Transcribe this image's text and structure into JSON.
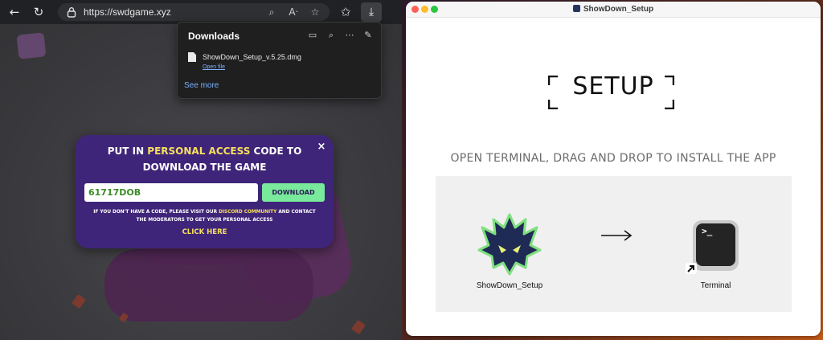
{
  "browser": {
    "url": "https://swdgame.xyz",
    "icons": {
      "back": "arrow-left-icon",
      "refresh": "refresh-icon",
      "lock": "lock-icon",
      "zoom": "zoom-icon",
      "read_aloud": "read-aloud-icon",
      "favorite": "star-icon",
      "favorites_bar": "favorites-icon",
      "download": "download-icon"
    },
    "downloads_panel": {
      "title": "Downloads",
      "file_name": "ShowDown_Setup_v.5.25.dmg",
      "open_file": "Open file",
      "see_more": "See more"
    }
  },
  "modal": {
    "title_line1_pre": "PUT IN ",
    "title_line1_highlight": "PERSONAL ACCESS",
    "title_line1_post": " CODE TO",
    "title_line2": "DOWNLOAD THE GAME",
    "code_value": "61717DOB",
    "download_label": "DOWNLOAD",
    "note_pre": "IF YOU DON'T HAVE A CODE, PLEASE VISIT OUR ",
    "note_highlight": "DISCORD COMMUNITY",
    "note_post": " AND CONTACT",
    "note_line2": "THE MODERATORS TO GET YOUR PERSONAL ACCESS",
    "click_here": "CLICK HERE",
    "close": "×",
    "colors": {
      "background": "#3f2579",
      "highlight": "#f6e05e",
      "button": "#79e99c"
    }
  },
  "installer": {
    "window_title": "ShowDown_Setup",
    "setup_label": "SETUP",
    "instruction": "OPEN TERMINAL, DRAG AND DROP TO INSTALL THE APP",
    "app_label": "ShowDown_Setup",
    "terminal_label": "Terminal",
    "terminal_prompt": ">_",
    "traffic_lights": [
      "#fe5f57",
      "#febc2e",
      "#28c840"
    ]
  }
}
